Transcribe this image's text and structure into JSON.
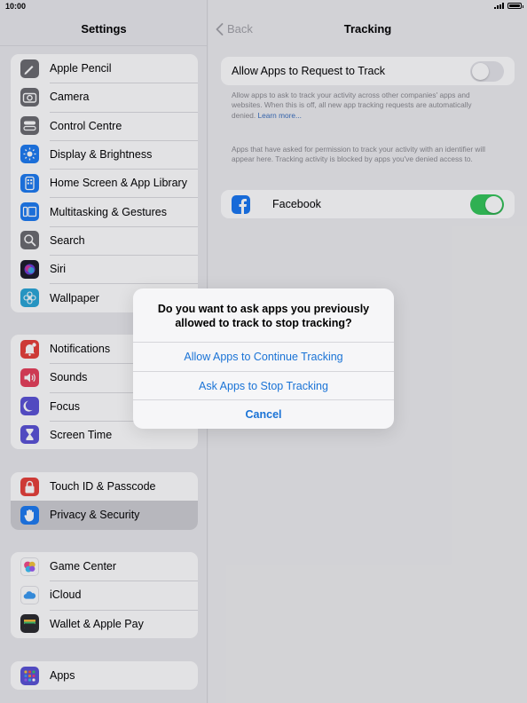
{
  "status_bar": {
    "time": "10:00"
  },
  "sidebar": {
    "title": "Settings",
    "groups": [
      [
        {
          "label": "Apple Pencil",
          "icon": "pencil-icon",
          "color": "#6b6b70"
        },
        {
          "label": "Camera",
          "icon": "camera-icon",
          "color": "#6b6b70"
        },
        {
          "label": "Control Centre",
          "icon": "toggles-icon",
          "color": "#6b6b70"
        },
        {
          "label": "Display & Brightness",
          "icon": "sun-icon",
          "color": "#1d7cf2"
        },
        {
          "label": "Home Screen & App Library",
          "icon": "home-screen-icon",
          "color": "#1d7cf2"
        },
        {
          "label": "Multitasking & Gestures",
          "icon": "multitasking-icon",
          "color": "#1d7cf2"
        },
        {
          "label": "Search",
          "icon": "magnifier-icon",
          "color": "#6b6b70"
        },
        {
          "label": "Siri",
          "icon": "siri-icon",
          "color": "#1c1c2a"
        },
        {
          "label": "Wallpaper",
          "icon": "flower-icon",
          "color": "#2aa7d8"
        }
      ],
      [
        {
          "label": "Notifications",
          "icon": "bell-icon",
          "color": "#e8403a"
        },
        {
          "label": "Sounds",
          "icon": "speaker-icon",
          "color": "#e8405a"
        },
        {
          "label": "Focus",
          "icon": "moon-icon",
          "color": "#5a52d6"
        },
        {
          "label": "Screen Time",
          "icon": "hourglass-icon",
          "color": "#5a52d6"
        }
      ],
      [
        {
          "label": "Touch ID & Passcode",
          "icon": "lock-icon",
          "color": "#e8403a"
        },
        {
          "label": "Privacy & Security",
          "icon": "hand-icon",
          "color": "#1d7cf2",
          "selected": true
        }
      ],
      [
        {
          "label": "Game Center",
          "icon": "game-center-icon",
          "color": "#ffffff"
        },
        {
          "label": "iCloud",
          "icon": "cloud-icon",
          "color": "#ffffff"
        },
        {
          "label": "Wallet & Apple Pay",
          "icon": "wallet-icon",
          "color": "#2b2b2e"
        }
      ],
      [
        {
          "label": "Apps",
          "icon": "apps-grid-icon",
          "color": "#5a52d6"
        }
      ]
    ]
  },
  "detail": {
    "back_label": "Back",
    "title": "Tracking",
    "allow_request": {
      "label": "Allow Apps to Request to Track",
      "on": false
    },
    "allow_footnote": "Allow apps to ask to track your activity across other companies' apps and websites. When this is off, all new app tracking requests are automatically denied.",
    "learn_more": "Learn more...",
    "apps_footnote": "Apps that have asked for permission to track your activity with an identifier will appear here. Tracking activity is blocked by apps you've denied access to.",
    "apps": [
      {
        "label": "Facebook",
        "on": true
      }
    ]
  },
  "alert": {
    "message": "Do you want to ask apps you previously allowed to track to stop tracking?",
    "buttons": [
      {
        "label": "Allow Apps to Continue Tracking",
        "bold": false
      },
      {
        "label": "Ask Apps to Stop Tracking",
        "bold": false
      },
      {
        "label": "Cancel",
        "bold": true
      }
    ]
  },
  "colors": {
    "accent": "#1a73d6",
    "toggle_on": "#34c759",
    "toggle_off": "#e5e5ea"
  }
}
